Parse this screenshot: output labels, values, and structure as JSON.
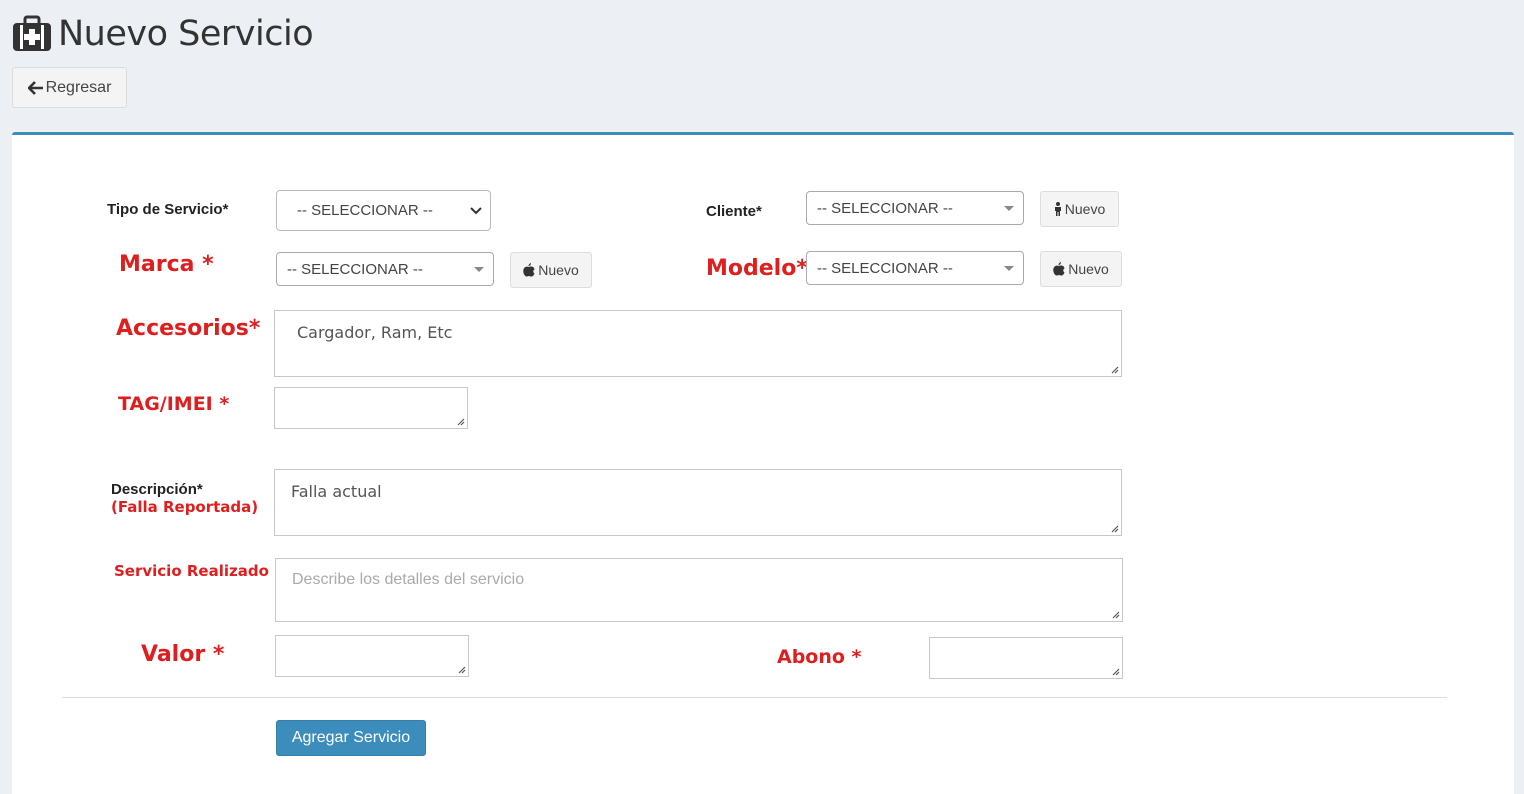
{
  "header": {
    "title": "Nuevo Servicio",
    "icon": "medkit-icon"
  },
  "back_button": {
    "label": "Regresar",
    "icon": "arrow-left-icon"
  },
  "form": {
    "tipo_servicio": {
      "label": "Tipo de Servicio*",
      "value": "-- SELECCIONAR --"
    },
    "cliente": {
      "label": "Cliente*",
      "value": "-- SELECCIONAR --",
      "new_label": "Nuevo",
      "new_icon": "male-icon"
    },
    "marca": {
      "label": "Marca *",
      "value": "-- SELECCIONAR --",
      "new_label": "Nuevo",
      "new_icon": "apple-icon"
    },
    "modelo": {
      "label": "Modelo*",
      "value": "-- SELECCIONAR --",
      "new_label": "Nuevo",
      "new_icon": "apple-icon"
    },
    "accesorios": {
      "label": "Accesorios*",
      "value": "Cargador, Ram, Etc"
    },
    "tag_imei": {
      "label": "TAG/IMEI *",
      "value": ""
    },
    "descripcion": {
      "label": "Descripción*",
      "sublabel": "(Falla Reportada)",
      "value": "Falla actual"
    },
    "servicio_realizado": {
      "label": "Servicio Realizado",
      "placeholder": "Describe los detalles del servicio"
    },
    "valor": {
      "label": "Valor *",
      "value": ""
    },
    "abono": {
      "label": "Abono *",
      "value": ""
    },
    "submit_label": "Agregar Servicio"
  },
  "colors": {
    "accent": "#3c8dbc",
    "required_label": "#dd1f1f",
    "background": "#ecf0f5"
  }
}
